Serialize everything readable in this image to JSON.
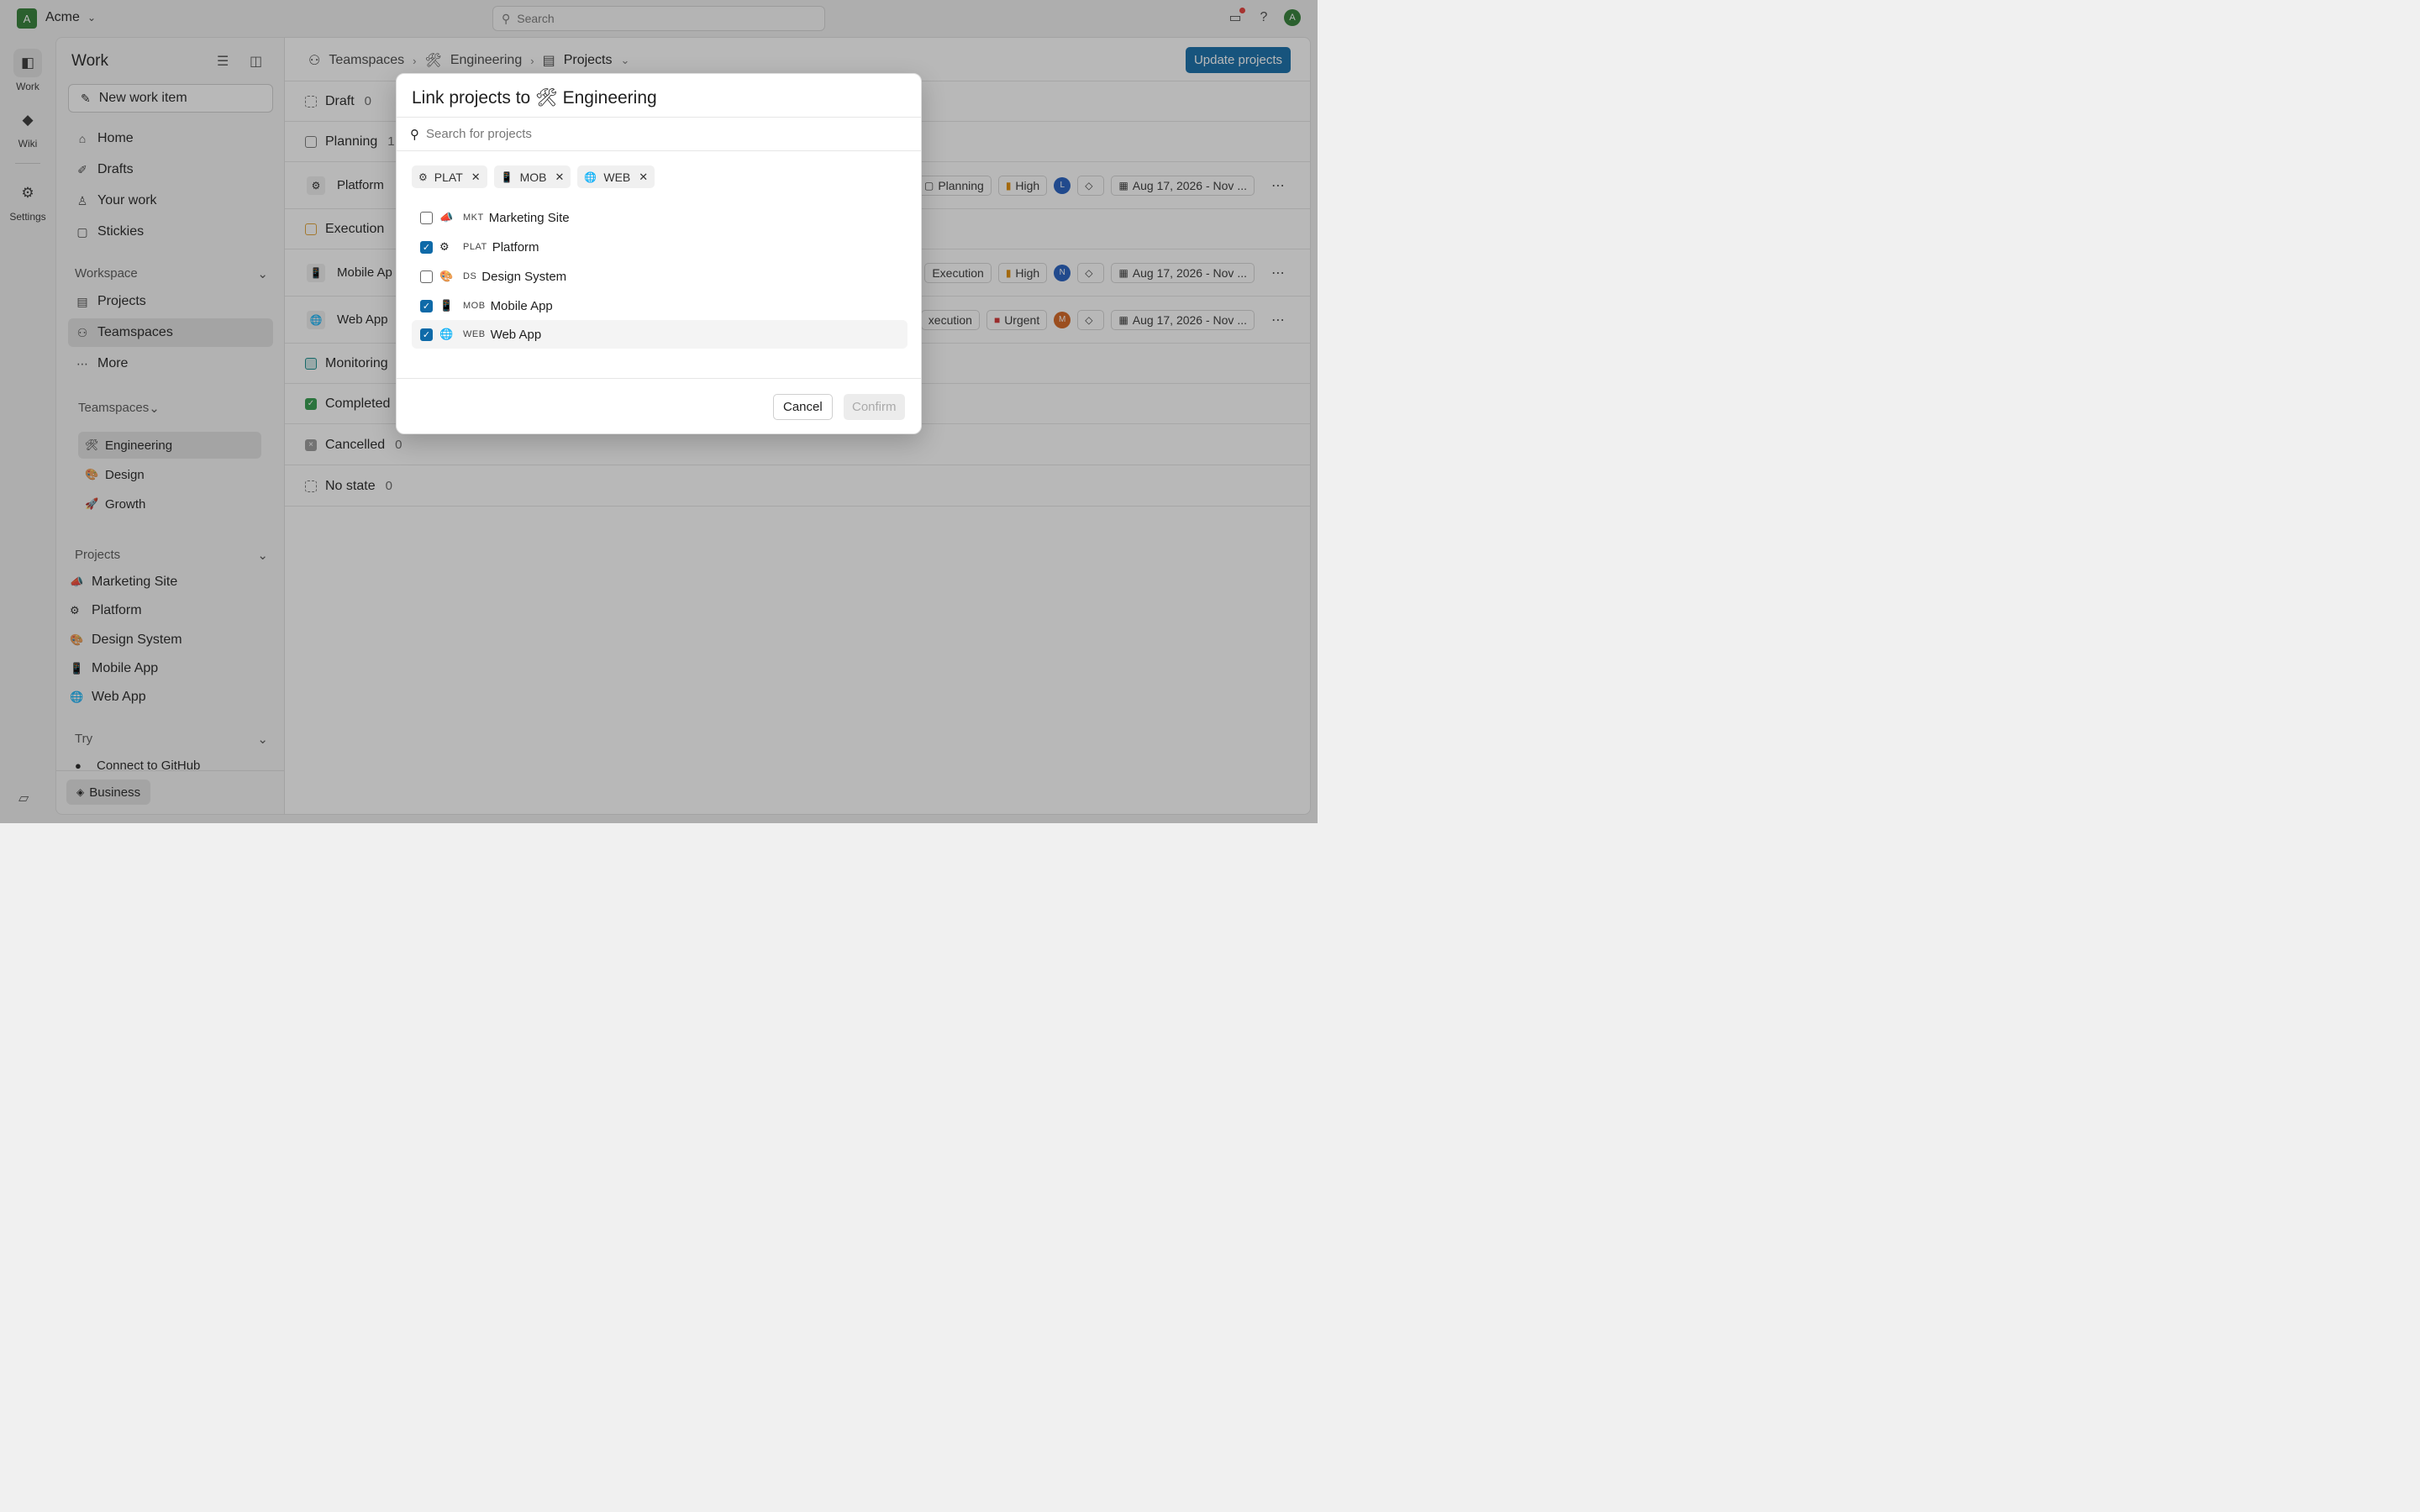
{
  "topbar": {
    "workspace_initial": "A",
    "workspace_name": "Acme",
    "search_placeholder": "Search",
    "user_initial": "A"
  },
  "rail": {
    "items": [
      {
        "label": "Work",
        "icon": "work-icon"
      },
      {
        "label": "Wiki",
        "icon": "wiki-icon"
      },
      {
        "label": "Settings",
        "icon": "gear-icon"
      }
    ]
  },
  "sidebar": {
    "title": "Work",
    "new_item_label": "New work item",
    "nav": [
      {
        "label": "Home",
        "icon": "home-icon"
      },
      {
        "label": "Drafts",
        "icon": "pen-icon"
      },
      {
        "label": "Your work",
        "icon": "user-icon"
      },
      {
        "label": "Stickies",
        "icon": "sticky-icon"
      }
    ],
    "workspace_heading": "Workspace",
    "workspace_items": [
      {
        "label": "Projects",
        "icon": "briefcase-icon"
      },
      {
        "label": "Teamspaces",
        "icon": "teamspace-icon"
      },
      {
        "label": "More",
        "icon": "more-icon"
      }
    ],
    "teamspaces_heading": "Teamspaces",
    "teamspaces": [
      {
        "label": "Engineering",
        "icon": "🛠"
      },
      {
        "label": "Design",
        "icon": "🎨"
      },
      {
        "label": "Growth",
        "icon": "🚀"
      }
    ],
    "projects_heading": "Projects",
    "projects": [
      {
        "label": "Marketing Site",
        "icon": "📣"
      },
      {
        "label": "Platform",
        "icon": "⚙"
      },
      {
        "label": "Design System",
        "icon": "🎨"
      },
      {
        "label": "Mobile App",
        "icon": "📱"
      },
      {
        "label": "Web App",
        "icon": "🌐"
      }
    ],
    "try_heading": "Try",
    "try_items": [
      {
        "label": "Connect to GitHub",
        "icon": "github-icon"
      }
    ],
    "plan_label": "Business"
  },
  "main": {
    "breadcrumb": {
      "teamspaces": "Teamspaces",
      "engineering": "Engineering",
      "engineering_icon": "🛠",
      "projects": "Projects"
    },
    "update_button": "Update projects",
    "groups": [
      {
        "name": "Draft",
        "count": "0",
        "color": "#888888"
      },
      {
        "name": "Planning",
        "count": "1",
        "color": "#888888"
      },
      {
        "name": "Execution",
        "count": "",
        "color": "#e0a030"
      },
      {
        "name": "Monitoring",
        "count": "",
        "color": "#0f8a8a"
      },
      {
        "name": "Completed",
        "count": "",
        "color": "#2e9a48"
      },
      {
        "name": "Cancelled",
        "count": "0",
        "color": "#888888"
      },
      {
        "name": "No state",
        "count": "0",
        "color": "#888888"
      }
    ],
    "rows": [
      {
        "name": "Platform",
        "icon": "⚙",
        "state": "Planning",
        "priority": "High",
        "assignee": "L",
        "assignee_color": "#1e5bbf",
        "dates": "Aug 17, 2026 - Nov ..."
      },
      {
        "name": "Mobile Ap",
        "icon": "📱",
        "state": "Execution",
        "priority": "High",
        "assignee": "N",
        "assignee_color": "#1e5bbf",
        "dates": "Aug 17, 2026 - Nov ..."
      },
      {
        "name": "Web App",
        "icon": "🌐",
        "state": "xecution",
        "priority": "Urgent",
        "assignee": "M",
        "assignee_color": "#d4621c",
        "dates": "Aug 17, 2026 - Nov ..."
      }
    ]
  },
  "modal": {
    "title_prefix": "Link projects to",
    "title_icon": "🛠",
    "title_target": "Engineering",
    "search_placeholder": "Search for projects",
    "selected_tags": [
      {
        "code": "PLAT",
        "icon": "⚙"
      },
      {
        "code": "MOB",
        "icon": "📱"
      },
      {
        "code": "WEB",
        "icon": "🌐"
      }
    ],
    "options": [
      {
        "code": "MKT",
        "name": "Marketing Site",
        "icon": "📣",
        "checked": false
      },
      {
        "code": "PLAT",
        "name": "Platform",
        "icon": "⚙",
        "checked": true
      },
      {
        "code": "DS",
        "name": "Design System",
        "icon": "🎨",
        "checked": false
      },
      {
        "code": "MOB",
        "name": "Mobile App",
        "icon": "📱",
        "checked": true
      },
      {
        "code": "WEB",
        "name": "Web App",
        "icon": "🌐",
        "checked": true
      }
    ],
    "cancel_label": "Cancel",
    "confirm_label": "Confirm"
  },
  "colors": {
    "accent": "#0f6aa8",
    "workspace_logo": "#2e7d32",
    "urgent": "#d32f2f",
    "high": "#e08a00"
  }
}
